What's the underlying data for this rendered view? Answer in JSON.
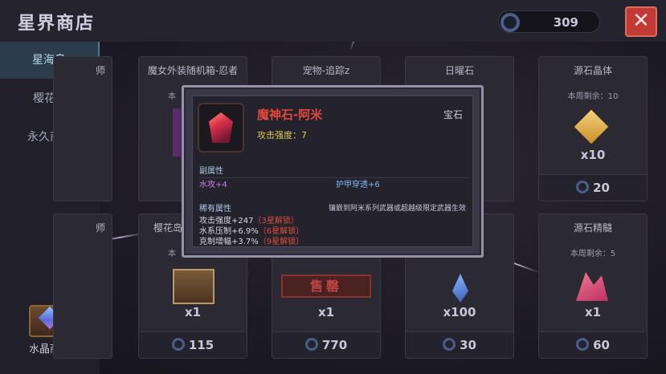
{
  "header": {
    "title": "星界商店",
    "currency_amount": "309",
    "close_label": "✕"
  },
  "sidebar": {
    "items": [
      {
        "label": "星海岛",
        "active": true
      },
      {
        "label": "樱花岛",
        "active": false
      },
      {
        "label": "永久商店",
        "active": false
      }
    ],
    "crystal_shop_label": "水晶商店"
  },
  "cards": [
    {
      "name": "师",
      "remain": "",
      "qty": "",
      "price": ""
    },
    {
      "name": "魔女外装随机箱-忍者",
      "remain": "本",
      "qty": "",
      "price": ""
    },
    {
      "name": "宠物-追踪z",
      "remain": "",
      "qty": "",
      "price": ""
    },
    {
      "name": "日曜石",
      "remain": "",
      "qty": "",
      "price": ""
    },
    {
      "name": "源石晶体",
      "remain": "本周剩余：10",
      "qty": "x10",
      "price": "20"
    },
    {
      "name": "师",
      "remain": "",
      "qty": "",
      "price": ""
    },
    {
      "name": "樱花岛",
      "remain": "本",
      "qty": "x1",
      "price": "115"
    },
    {
      "name": "",
      "remain": "",
      "qty": "x1",
      "price": "770",
      "soldout": "售罄"
    },
    {
      "name": "",
      "remain": "",
      "qty": "x100",
      "price": "30"
    },
    {
      "name": "源石精髓",
      "remain": "本周剩余：5",
      "qty": "x1",
      "price": "60"
    }
  ],
  "popup": {
    "name": "魔神石-阿米",
    "type": "宝石",
    "main_stat": "攻击强度：7",
    "sub_header": "副属性",
    "sub_stats": [
      "水攻+4",
      "护甲穿透+6"
    ],
    "rare_header": "稀有属性",
    "rare_note": "镶嵌到阿米系列武器或超越级限定武器生效",
    "rare_stats": [
      {
        "text": "攻击强度+247",
        "lock": "（3星解锁）"
      },
      {
        "text": "水系压制+6.9%",
        "lock": "（6星解锁）"
      },
      {
        "text": "克制增幅+3.7%",
        "lock": "（9星解锁）"
      }
    ]
  },
  "colors": {
    "accent_red": "#e4463e",
    "sidebar_active": "#2b3d4c",
    "popup_border": "#9690aa",
    "stat_gold": "#e0c85a"
  },
  "icons": [
    "coin-icon",
    "close-icon",
    "crystal-chest-icon",
    "gem-icon"
  ]
}
